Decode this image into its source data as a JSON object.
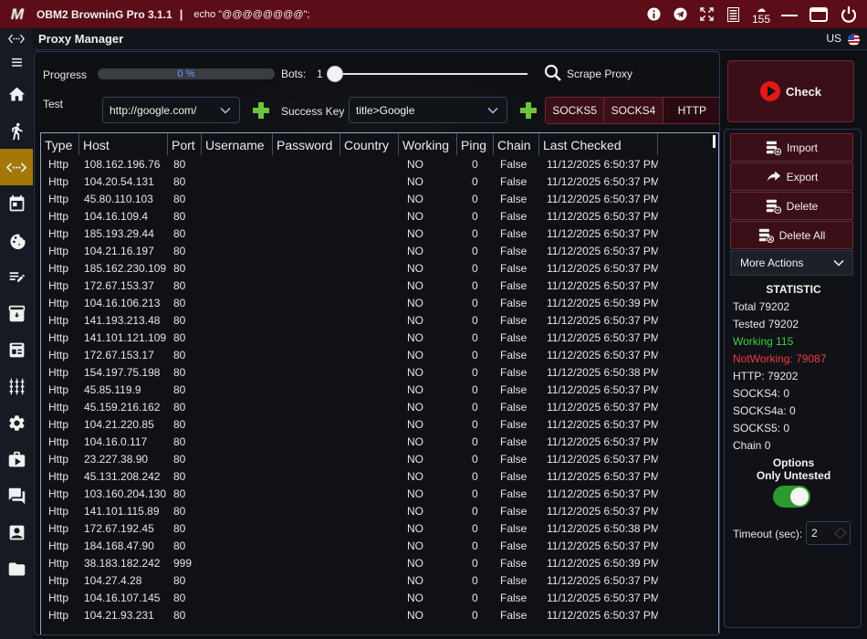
{
  "titlebar": {
    "logo": "M",
    "app_title": "OBM2 BrowninG Pro  3.1.1",
    "separator": "|",
    "echo": "echo \"@@@@@@@@\";",
    "notification_count": "155"
  },
  "header": {
    "page_title": "Proxy Manager",
    "language": "US"
  },
  "controls": {
    "progress_label": "Progress",
    "progress_value": 0,
    "progress_text": "0 %",
    "bots_label": "Bots:",
    "bots_value": "1",
    "scrape_label": "Scrape Proxy",
    "test_label": "Test",
    "test_url": "http://google.com/",
    "success_key_label": "Success Key",
    "success_key_value": "title>Google",
    "protocols": [
      "SOCKS5",
      "SOCKS4",
      "HTTP"
    ]
  },
  "table": {
    "columns": [
      "Type",
      "Host",
      "Port",
      "Username",
      "Password",
      "Country",
      "Working",
      "Ping",
      "Chain",
      "Last Checked"
    ],
    "rows": [
      [
        "Http",
        "108.162.196.76",
        "80",
        "",
        "",
        "",
        "NO",
        "0",
        "False",
        "11/12/2025 6:50:37 PM"
      ],
      [
        "Http",
        "104.20.54.131",
        "80",
        "",
        "",
        "",
        "NO",
        "0",
        "False",
        "11/12/2025 6:50:37 PM"
      ],
      [
        "Http",
        "45.80.110.103",
        "80",
        "",
        "",
        "",
        "NO",
        "0",
        "False",
        "11/12/2025 6:50:37 PM"
      ],
      [
        "Http",
        "104.16.109.4",
        "80",
        "",
        "",
        "",
        "NO",
        "0",
        "False",
        "11/12/2025 6:50:37 PM"
      ],
      [
        "Http",
        "185.193.29.44",
        "80",
        "",
        "",
        "",
        "NO",
        "0",
        "False",
        "11/12/2025 6:50:37 PM"
      ],
      [
        "Http",
        "104.21.16.197",
        "80",
        "",
        "",
        "",
        "NO",
        "0",
        "False",
        "11/12/2025 6:50:37 PM"
      ],
      [
        "Http",
        "185.162.230.109",
        "80",
        "",
        "",
        "",
        "NO",
        "0",
        "False",
        "11/12/2025 6:50:37 PM"
      ],
      [
        "Http",
        "172.67.153.37",
        "80",
        "",
        "",
        "",
        "NO",
        "0",
        "False",
        "11/12/2025 6:50:37 PM"
      ],
      [
        "Http",
        "104.16.106.213",
        "80",
        "",
        "",
        "",
        "NO",
        "0",
        "False",
        "11/12/2025 6:50:39 PM"
      ],
      [
        "Http",
        "141.193.213.48",
        "80",
        "",
        "",
        "",
        "NO",
        "0",
        "False",
        "11/12/2025 6:50:37 PM"
      ],
      [
        "Http",
        "141.101.121.109",
        "80",
        "",
        "",
        "",
        "NO",
        "0",
        "False",
        "11/12/2025 6:50:37 PM"
      ],
      [
        "Http",
        "172.67.153.17",
        "80",
        "",
        "",
        "",
        "NO",
        "0",
        "False",
        "11/12/2025 6:50:37 PM"
      ],
      [
        "Http",
        "154.197.75.198",
        "80",
        "",
        "",
        "",
        "NO",
        "0",
        "False",
        "11/12/2025 6:50:38 PM"
      ],
      [
        "Http",
        "45.85.119.9",
        "80",
        "",
        "",
        "",
        "NO",
        "0",
        "False",
        "11/12/2025 6:50:37 PM"
      ],
      [
        "Http",
        "45.159.216.162",
        "80",
        "",
        "",
        "",
        "NO",
        "0",
        "False",
        "11/12/2025 6:50:37 PM"
      ],
      [
        "Http",
        "104.21.220.85",
        "80",
        "",
        "",
        "",
        "NO",
        "0",
        "False",
        "11/12/2025 6:50:37 PM"
      ],
      [
        "Http",
        "104.16.0.117",
        "80",
        "",
        "",
        "",
        "NO",
        "0",
        "False",
        "11/12/2025 6:50:37 PM"
      ],
      [
        "Http",
        "23.227.38.90",
        "80",
        "",
        "",
        "",
        "NO",
        "0",
        "False",
        "11/12/2025 6:50:37 PM"
      ],
      [
        "Http",
        "45.131.208.242",
        "80",
        "",
        "",
        "",
        "NO",
        "0",
        "False",
        "11/12/2025 6:50:37 PM"
      ],
      [
        "Http",
        "103.160.204.130",
        "80",
        "",
        "",
        "",
        "NO",
        "0",
        "False",
        "11/12/2025 6:50:37 PM"
      ],
      [
        "Http",
        "141.101.115.89",
        "80",
        "",
        "",
        "",
        "NO",
        "0",
        "False",
        "11/12/2025 6:50:37 PM"
      ],
      [
        "Http",
        "172.67.192.45",
        "80",
        "",
        "",
        "",
        "NO",
        "0",
        "False",
        "11/12/2025 6:50:38 PM"
      ],
      [
        "Http",
        "184.168.47.90",
        "80",
        "",
        "",
        "",
        "NO",
        "0",
        "False",
        "11/12/2025 6:50:37 PM"
      ],
      [
        "Http",
        "38.183.182.242",
        "999",
        "",
        "",
        "",
        "NO",
        "0",
        "False",
        "11/12/2025 6:50:39 PM"
      ],
      [
        "Http",
        "104.27.4.28",
        "80",
        "",
        "",
        "",
        "NO",
        "0",
        "False",
        "11/12/2025 6:50:37 PM"
      ],
      [
        "Http",
        "104.16.107.145",
        "80",
        "",
        "",
        "",
        "NO",
        "0",
        "False",
        "11/12/2025 6:50:37 PM"
      ],
      [
        "Http",
        "104.21.93.231",
        "80",
        "",
        "",
        "",
        "NO",
        "0",
        "False",
        "11/12/2025 6:50:37 PM"
      ]
    ]
  },
  "actions": {
    "check": "Check",
    "import": "Import",
    "export": "Export",
    "delete": "Delete",
    "delete_all": "Delete All",
    "more_actions": "More Actions"
  },
  "statistic": {
    "title": "STATISTIC",
    "total": "Total   79202",
    "tested": "Tested   79202",
    "working": "Working   115",
    "not_working": "NotWorking:   79087",
    "http": "HTTP:   79202",
    "socks4": "SOCKS4:    0",
    "socks4a": "SOCKS4a:    0",
    "socks5": "SOCKS5:    0",
    "chain": "Chain    0"
  },
  "options": {
    "title": "Options",
    "only_untested_label": "Only Untested",
    "only_untested": true,
    "timeout_label": "Timeout (sec):",
    "timeout_value": "2"
  },
  "colors": {
    "title_bar": "#5c0d17",
    "sidebar_active": "#a37807",
    "accent_button": "#3b0f17",
    "working": "#3fd13f",
    "not_working": "#f03c3c",
    "toggle_on": "#2e9a2e"
  }
}
